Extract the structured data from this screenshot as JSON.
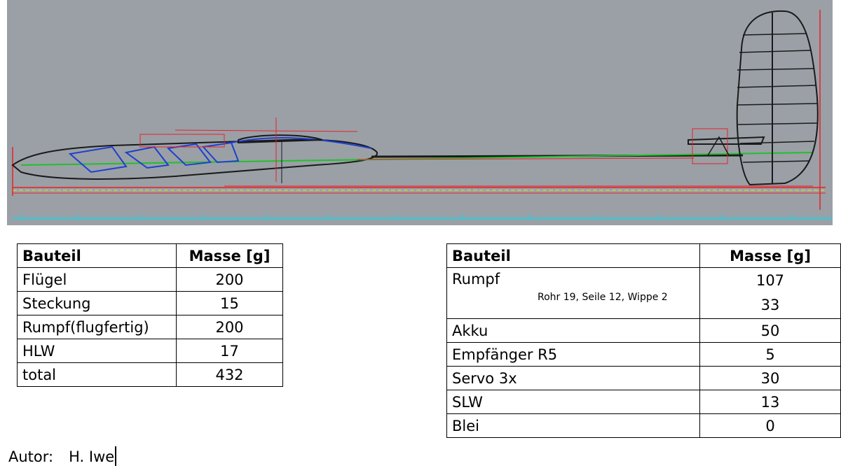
{
  "drawing": {
    "description_icon": "glider-side-view-cad-drawing",
    "colors": {
      "background": "#9aa0a6",
      "structure": "#1a1a1a",
      "red_lines": "#e8202a",
      "blue_parts": "#1f3fd0",
      "green_axis": "#22c02a",
      "yellow_ref": "#e6e600",
      "cyan_scale": "#22d0e0"
    }
  },
  "left_table": {
    "headers": [
      "Bauteil",
      "Masse [g]"
    ],
    "rows": [
      {
        "part": "Flügel",
        "mass": "200"
      },
      {
        "part": "Steckung",
        "mass": "15"
      },
      {
        "part": "Rumpf(flugfertig)",
        "mass": "200"
      },
      {
        "part": "HLW",
        "mass": "17"
      },
      {
        "part": "total",
        "mass": "432"
      }
    ]
  },
  "right_table": {
    "headers": [
      "Bauteil",
      "Masse [g]"
    ],
    "rumpf": {
      "part": "Rumpf",
      "note": "Rohr 19, Seile 12, Wippe 2",
      "mass1": "107",
      "mass2": "33"
    },
    "rows": [
      {
        "part": "Akku",
        "mass": "50"
      },
      {
        "part": "Empfänger R5",
        "mass": "5"
      },
      {
        "part": "Servo 3x",
        "mass": "30"
      },
      {
        "part": "SLW",
        "mass": "13"
      },
      {
        "part": "Blei",
        "mass": "0"
      }
    ]
  },
  "author": {
    "label": "Autor:",
    "name": "H. Iwe"
  }
}
